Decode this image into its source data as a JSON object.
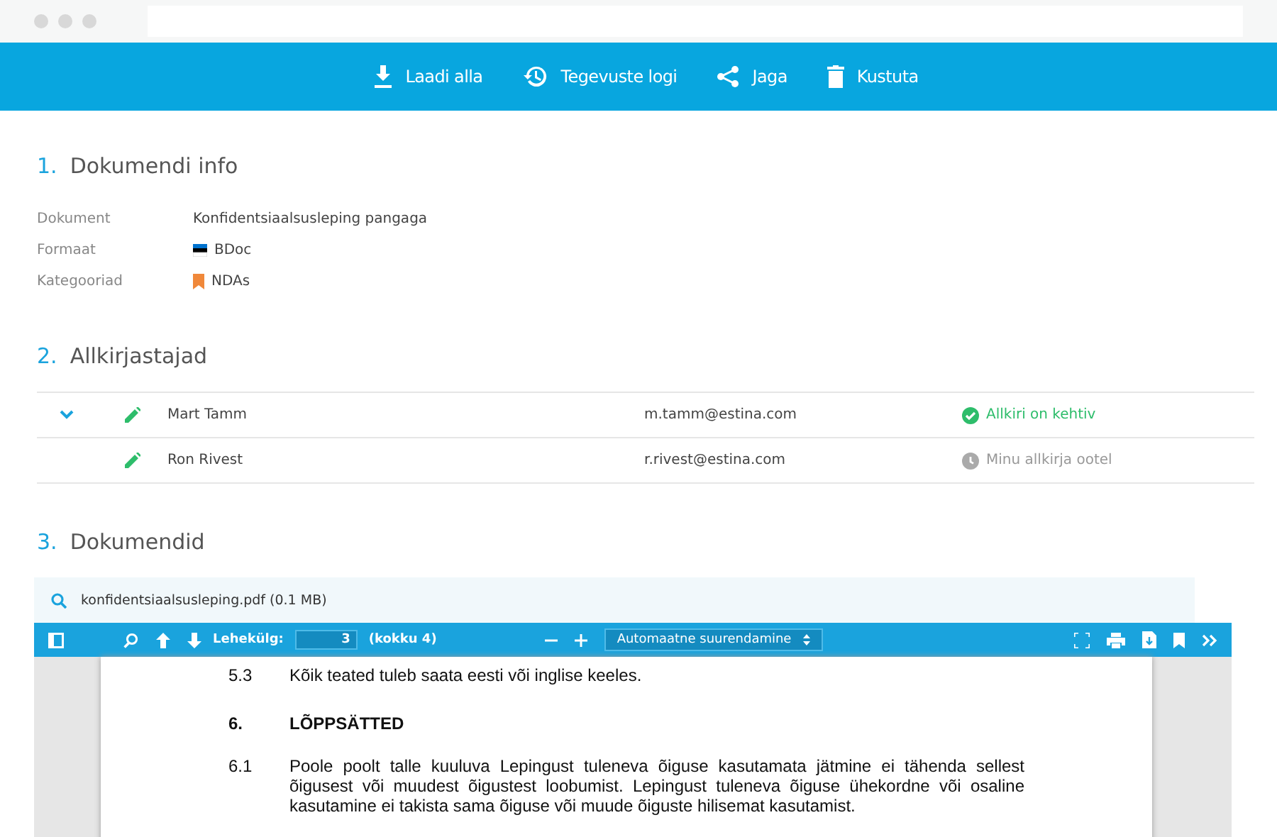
{
  "actions": [
    {
      "kind": "download",
      "label": "Laadi alla"
    },
    {
      "kind": "history",
      "label": "Tegevuste logi"
    },
    {
      "kind": "share",
      "label": "Jaga"
    },
    {
      "kind": "delete",
      "label": "Kustuta"
    }
  ],
  "sections": [
    {
      "number": "1.",
      "title": "Dokumendi info"
    },
    {
      "number": "2.",
      "title": "Allkirjastajad"
    },
    {
      "number": "3.",
      "title": "Dokumendid"
    }
  ],
  "info": [
    {
      "label": "Dokument",
      "value": "Konfidentsiaalsusleping pangaga",
      "kind": "text"
    },
    {
      "label": "Formaat",
      "value": "BDoc",
      "kind": "format"
    },
    {
      "label": "Kategooriad",
      "value": "NDAs",
      "kind": "category",
      "color": "#f0883a"
    }
  ],
  "signers": [
    {
      "expandable": true,
      "name": "Mart Tamm",
      "email": "m.tamm@estina.com",
      "status": "Allkiri on kehtiv",
      "kind": "valid"
    },
    {
      "expandable": false,
      "name": "Ron Rivest",
      "email": "r.rivest@estina.com",
      "status": "Minu allkirja ootel",
      "kind": "pending"
    }
  ],
  "file": "konfidentsiaalsusleping.pdf (0.1 MB)",
  "viewer": {
    "page_label": "Lehekülg:",
    "page": "3",
    "page_total": "(kokku 4)",
    "zoom": "Automaatne suurendamine"
  },
  "pdf": [
    {
      "number": "5.3",
      "text": "Kõik teated tuleb saata eesti või inglise keeles.",
      "kind": "para"
    },
    {
      "number": "6.",
      "text": "LÕPPSÄTTED",
      "kind": "heading"
    },
    {
      "number": "6.1",
      "text": "Poole poolt talle kuuluva Lepingust tuleneva õiguse kasutamata jätmine ei tähenda sellest õigusest või muudest õigustest loobumist. Lepingust tuleneva õiguse ühekordne või osaline kasutamine ei takista sama õiguse või muude õiguste hilisemat kasutamist.",
      "kind": "para"
    }
  ]
}
